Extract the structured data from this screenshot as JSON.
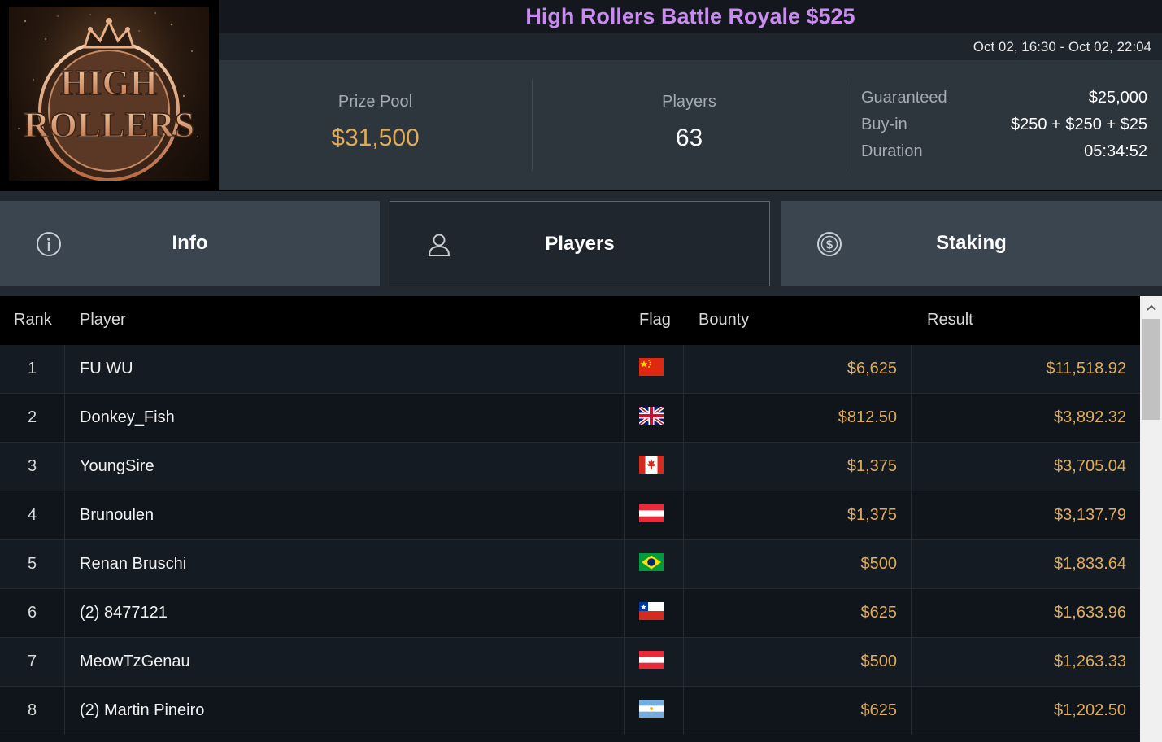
{
  "logo": {
    "line1": "HIGH",
    "line2": "ROLLERS"
  },
  "title": "High Rollers Battle Royale $525",
  "date_range": "Oct 02, 16:30 - Oct 02, 22:04",
  "stats": {
    "prize_pool_label": "Prize Pool",
    "prize_pool_value": "$31,500",
    "players_label": "Players",
    "players_value": "63",
    "details": [
      {
        "label": "Guaranteed",
        "value": "$25,000"
      },
      {
        "label": "Buy-in",
        "value": "$250 + $250 + $25"
      },
      {
        "label": "Duration",
        "value": "05:34:52"
      }
    ]
  },
  "tabs": [
    {
      "label": "Info",
      "icon": "info-icon"
    },
    {
      "label": "Players",
      "icon": "user-icon",
      "active": true
    },
    {
      "label": "Staking",
      "icon": "dollar-coin-icon"
    }
  ],
  "table": {
    "headers": {
      "rank": "Rank",
      "player": "Player",
      "flag": "Flag",
      "bounty": "Bounty",
      "result": "Result"
    },
    "rows": [
      {
        "rank": "1",
        "player": "FU WU",
        "flag": "china",
        "bounty": "$6,625",
        "result": "$11,518.92"
      },
      {
        "rank": "2",
        "player": "Donkey_Fish",
        "flag": "uk",
        "bounty": "$812.50",
        "result": "$3,892.32"
      },
      {
        "rank": "3",
        "player": "YoungSire",
        "flag": "canada",
        "bounty": "$1,375",
        "result": "$3,705.04"
      },
      {
        "rank": "4",
        "player": "Brunoulen",
        "flag": "austria",
        "bounty": "$1,375",
        "result": "$3,137.79"
      },
      {
        "rank": "5",
        "player": "Renan Bruschi",
        "flag": "brazil",
        "bounty": "$500",
        "result": "$1,833.64"
      },
      {
        "rank": "6",
        "player": "(2) 8477121",
        "flag": "chile",
        "bounty": "$625",
        "result": "$1,633.96"
      },
      {
        "rank": "7",
        "player": "MeowTzGenau",
        "flag": "austria",
        "bounty": "$500",
        "result": "$1,263.33"
      },
      {
        "rank": "8",
        "player": "(2) Martin Pineiro",
        "flag": "argentina",
        "bounty": "$625",
        "result": "$1,202.50"
      }
    ]
  },
  "colors": {
    "accent_gold": "#e0ac5a",
    "title_purple": "#c98bf0"
  }
}
